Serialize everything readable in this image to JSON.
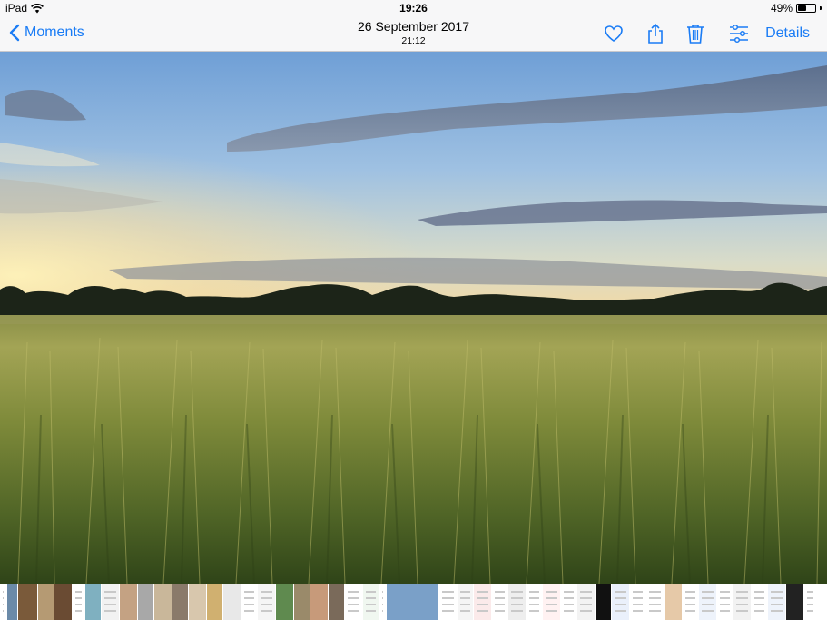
{
  "status_bar": {
    "device": "iPad",
    "time": "19:26",
    "battery": "49%",
    "battery_level": 0.49
  },
  "nav": {
    "back_label": "Moments",
    "date": "26 September 2017",
    "time": "21:12",
    "details_label": "Details",
    "icons": [
      "chevron-left-icon",
      "heart-icon",
      "share-icon",
      "trash-icon",
      "adjust-icon"
    ]
  },
  "accent_color": "#1a7cf5",
  "filmstrip": [
    {
      "kind": "doc",
      "color": "#ffffff",
      "w": 8
    },
    {
      "kind": "photo",
      "color": "#6b8aa8",
      "w": 12
    },
    {
      "kind": "photo",
      "color": "#7a5a3a",
      "w": 22
    },
    {
      "kind": "photo",
      "color": "#b59a73",
      "w": 18
    },
    {
      "kind": "photo",
      "color": "#6a4b33",
      "w": 20
    },
    {
      "kind": "doc",
      "color": "#ffffff",
      "w": 14
    },
    {
      "kind": "photo",
      "color": "#7fb0c0",
      "w": 18
    },
    {
      "kind": "doc",
      "color": "#f2f2f2",
      "w": 20
    },
    {
      "kind": "photo",
      "color": "#c4a283",
      "w": 20
    },
    {
      "kind": "photo",
      "color": "#a8a8a8",
      "w": 18
    },
    {
      "kind": "photo",
      "color": "#c9b79a",
      "w": 20
    },
    {
      "kind": "photo",
      "color": "#8a7a6a",
      "w": 18
    },
    {
      "kind": "photo",
      "color": "#d8c7ad",
      "w": 20
    },
    {
      "kind": "photo",
      "color": "#d0b070",
      "w": 18
    },
    {
      "kind": "photo",
      "color": "#e8e8e8",
      "w": 20
    },
    {
      "kind": "doc",
      "color": "#ffffff",
      "w": 18
    },
    {
      "kind": "doc",
      "color": "#f5f5f5",
      "w": 20
    },
    {
      "kind": "photo",
      "color": "#5f8a4f",
      "w": 20
    },
    {
      "kind": "photo",
      "color": "#9a8a6a",
      "w": 18
    },
    {
      "kind": "photo",
      "color": "#c79a7a",
      "w": 20
    },
    {
      "kind": "photo",
      "color": "#7a6a5a",
      "w": 18
    },
    {
      "kind": "doc",
      "color": "#ffffff",
      "w": 20
    },
    {
      "kind": "doc",
      "color": "#f0f7f0",
      "w": 18
    },
    {
      "kind": "doc",
      "color": "#ffffff",
      "w": 8
    },
    {
      "kind": "photo",
      "color": "#7aa0c8",
      "w": 58
    },
    {
      "kind": "doc",
      "color": "#ffffff",
      "w": 20
    },
    {
      "kind": "doc",
      "color": "#f5f5f5",
      "w": 18
    },
    {
      "kind": "doc",
      "color": "#fbeaea",
      "w": 20
    },
    {
      "kind": "doc",
      "color": "#ffffff",
      "w": 18
    },
    {
      "kind": "doc",
      "color": "#eeeeee",
      "w": 20
    },
    {
      "kind": "doc",
      "color": "#ffffff",
      "w": 18
    },
    {
      "kind": "doc",
      "color": "#fff2f2",
      "w": 20
    },
    {
      "kind": "doc",
      "color": "#ffffff",
      "w": 18
    },
    {
      "kind": "doc",
      "color": "#f3f3f3",
      "w": 20
    },
    {
      "kind": "photo",
      "color": "#111111",
      "w": 18
    },
    {
      "kind": "doc",
      "color": "#eaf0fb",
      "w": 20
    },
    {
      "kind": "doc",
      "color": "#ffffff",
      "w": 18
    },
    {
      "kind": "doc",
      "color": "#ffffff",
      "w": 20
    },
    {
      "kind": "photo",
      "color": "#e6c9a8",
      "w": 20
    },
    {
      "kind": "doc",
      "color": "#ffffff",
      "w": 18
    },
    {
      "kind": "doc",
      "color": "#eef3fb",
      "w": 20
    },
    {
      "kind": "doc",
      "color": "#ffffff",
      "w": 18
    },
    {
      "kind": "doc",
      "color": "#f2f2f2",
      "w": 20
    },
    {
      "kind": "doc",
      "color": "#ffffff",
      "w": 18
    },
    {
      "kind": "doc",
      "color": "#eef3fb",
      "w": 20
    },
    {
      "kind": "photo",
      "color": "#222222",
      "w": 20
    },
    {
      "kind": "doc",
      "color": "#ffffff",
      "w": 14
    }
  ]
}
